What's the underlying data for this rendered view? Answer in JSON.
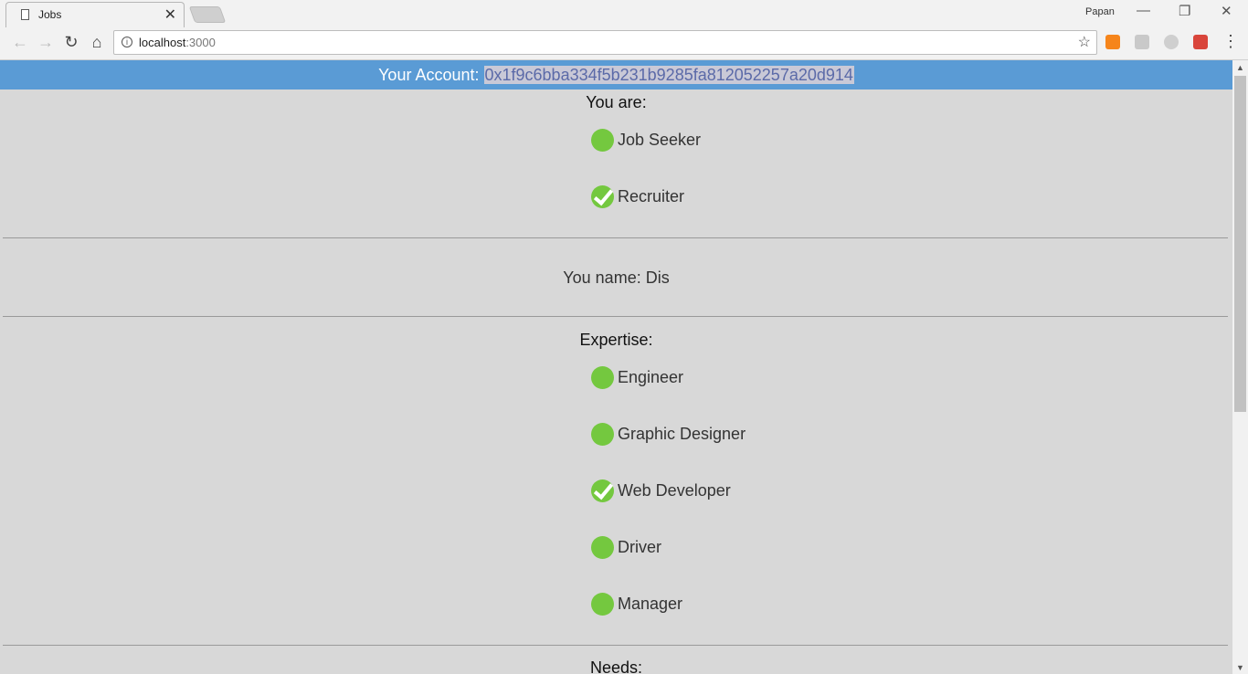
{
  "browser": {
    "tab_title": "Jobs",
    "tab_close": "✕",
    "profile_name": "Papan",
    "url_host": "localhost",
    "url_port": ":3000",
    "window_buttons": {
      "minimize": "—",
      "restore": "❐",
      "close": "✕"
    },
    "nav": {
      "back": "←",
      "forward": "→",
      "reload": "↻",
      "home": "⌂",
      "star": "☆",
      "menu": "⋮"
    },
    "extension_icons": [
      "metamask-icon",
      "settings-extension-icon",
      "circle-extension-icon",
      "shield-extension-icon"
    ],
    "extension_colors": [
      "#f6851b",
      "#c9c9c9",
      "#cfcfcf",
      "#d9453b"
    ]
  },
  "account": {
    "label": "Your Account: ",
    "address": "0x1f9c6bba334f5b231b9285fa812052257a20d914"
  },
  "role": {
    "heading": "You are:",
    "options": [
      {
        "label": "Job Seeker",
        "checked": false
      },
      {
        "label": "Recruiter",
        "checked": true
      }
    ]
  },
  "name": {
    "text": "You name: Dis"
  },
  "expertise": {
    "heading": "Expertise:",
    "options": [
      {
        "label": "Engineer",
        "checked": false
      },
      {
        "label": "Graphic Designer",
        "checked": false
      },
      {
        "label": "Web Developer",
        "checked": true
      },
      {
        "label": "Driver",
        "checked": false
      },
      {
        "label": "Manager",
        "checked": false
      }
    ]
  },
  "needs": {
    "heading": "Needs:"
  },
  "colors": {
    "account_bar": "#5a9bd5",
    "radio_green": "#74c83f",
    "page_background": "#d8d8d8"
  }
}
